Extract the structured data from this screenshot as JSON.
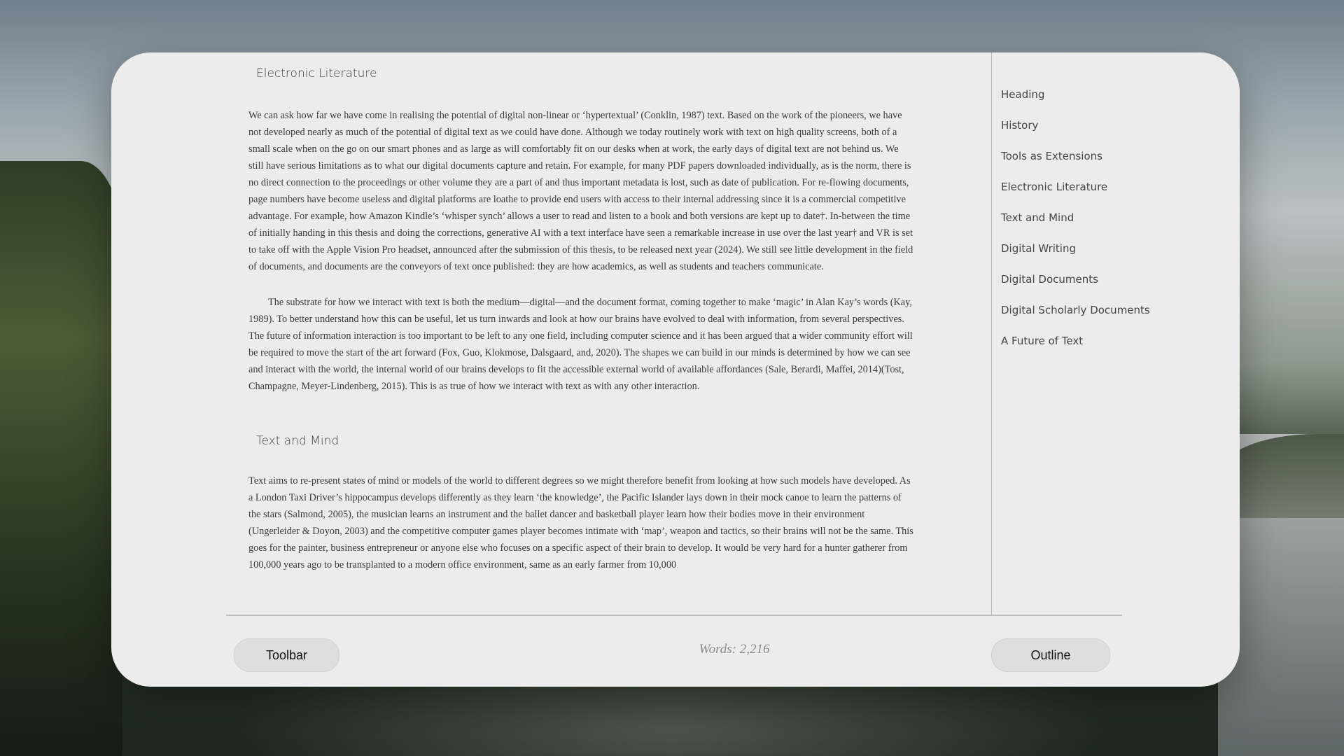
{
  "document": {
    "sections": [
      {
        "heading": "Electronic Literature",
        "paragraphs": [
          "We can ask how far we have come in realising the potential of digital non-linear or ‘hypertextual’ (Conklin, 1987) text. Based on the work of the pioneers, we have not developed nearly as much of the potential of digital text as we could have done. Although we today routinely work with text on high quality screens, both of a small scale when on the go on our smart phones and as large as will comfortably fit on our desks when at work, the early days of digital text are not behind us. We still have serious limitations as to what our digital documents capture and retain. For example, for many PDF papers downloaded individually, as is the norm, there is no direct connection to the proceedings or other volume they are a part of and thus important metadata is lost, such as date of publication. For re-flowing documents, page numbers have become useless and digital platforms are loathe to provide end users with access to their internal addressing since it is a commercial competitive advantage. For example, how Amazon Kindle’s ‘whisper synch’ allows a user to read and listen to a book and both versions are kept up to date†. In-between the time of initially handing in this thesis and doing the corrections, generative AI with a text interface have seen a remarkable increase in use over the last year† and VR is set to take off with the Apple Vision Pro headset, announced after the submission of this thesis, to be released next year (2024). We still see little development in the field of documents, and documents are the conveyors of text once published: they are how academics, as well as students and teachers communicate.",
          "The substrate for how we interact with text is both the medium—digital—and the document format, coming together to make ‘magic’ in Alan Kay’s words (Kay, 1989). To better understand how this can be useful, let us turn inwards and look at how our brains have evolved to deal with information, from several perspectives. The future of information interaction is too important to be left to any one field, including computer science and it has been argued that a wider community effort will be required to move the start of the art forward (Fox, Guo, Klokmose, Dalsgaard, and, 2020). The shapes we can build in our minds is determined by how we can see and interact with the world, the internal world of our brains develops to fit the accessible external world of available affordances (Sale, Berardi, Maffei, 2014)(Tost, Champagne, Meyer-Lindenberg, 2015). This is as true of how we interact with text as with any other interaction."
        ]
      },
      {
        "heading": "Text and Mind",
        "paragraphs": [
          "Text aims to re-present states of mind or models of the world to different degrees so we might therefore benefit from looking at how such models have developed. As a London Taxi Driver’s hippocampus develops differently as they learn ‘the knowledge’, the Pacific Islander lays down in their mock canoe to learn the patterns of the stars (Salmond, 2005), the musician learns an instrument and the ballet dancer and basketball player learn how their bodies move in their environment (Ungerleider & Doyon, 2003) and the competitive computer games player becomes intimate with ‘map’, weapon and tactics, so their brains will not be the same. This goes for the painter, business entrepreneur or anyone else who focuses on a specific aspect of their brain to develop. It would be very hard for a hunter gatherer from 100,000 years ago to be transplanted to a modern office environment, same as an early farmer from 10,000"
        ]
      }
    ]
  },
  "outline": {
    "items": [
      "Heading",
      "History",
      "Tools as Extensions",
      "Electronic Literature",
      "Text and Mind",
      "Digital Writing",
      "Digital Documents",
      "Digital Scholarly Documents",
      "A Future of Text"
    ]
  },
  "footer": {
    "toolbar_label": "Toolbar",
    "word_count": "Words: 2,216",
    "outline_label": "Outline"
  },
  "colors": {
    "window_bg": "#ececec",
    "button_bg": "#dedede",
    "text": "#3a3a3a",
    "muted": "#8b8b8b"
  }
}
